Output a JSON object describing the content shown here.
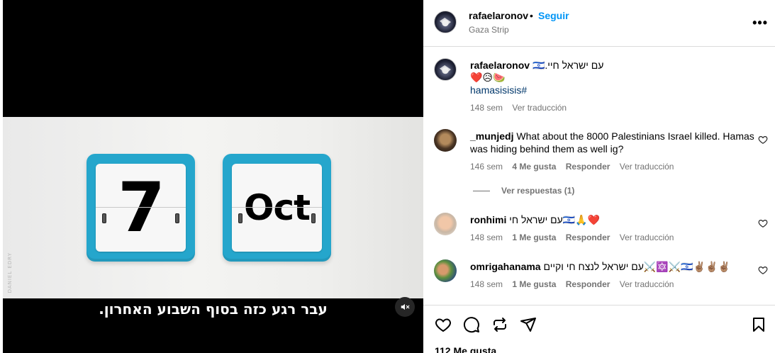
{
  "media": {
    "day": "7",
    "month": "Oct",
    "credit": "DANIEL EDRY",
    "subtitle": "עבר רגע כזה בסוף השבוע האחרון.",
    "mute_icon": "speaker-muted-icon"
  },
  "header": {
    "username": "rafaelaronov",
    "separator": "•",
    "follow_label": "Seguir",
    "location": "Gaza Strip",
    "more_label": "•••"
  },
  "caption": {
    "username": "rafaelaronov",
    "text": "עם ישראל חיי.🇮🇱",
    "emojis": "❤️😥🍉",
    "hashtag": "hamasisisis#",
    "age": "148 sem",
    "translate": "Ver traducción"
  },
  "comments": [
    {
      "username": "_munjedj",
      "text_line1": "What about the 8000 Palestinians Israel killed. Hamas",
      "text_line2": "was hiding behind them as well ig?",
      "age": "146 sem",
      "likes": "4 Me gusta",
      "reply": "Responder",
      "translate": "Ver traducción",
      "view_replies": "Ver respuestas (1)"
    },
    {
      "username": "ronhimi",
      "text": "❤️🙏🇮🇱עם ישראל חי",
      "age": "148 sem",
      "likes": "1 Me gusta",
      "reply": "Responder",
      "translate": "Ver traducción"
    },
    {
      "username": "omrigahanama",
      "text": "✌🏽✌🏽✌🏽🇮🇱⚔️🔯⚔️עם ישראל לנצח חי וקיים",
      "age": "148 sem",
      "likes": "1 Me gusta",
      "reply": "Responder",
      "translate": "Ver traducción"
    }
  ],
  "footer": {
    "likes_count": "112 Me gusta"
  },
  "colors": {
    "accent": "#0095f6",
    "hashtag": "#00376b",
    "muted": "#737373",
    "divider": "#dbdbdb",
    "flip_frame": "#25a6cc"
  }
}
